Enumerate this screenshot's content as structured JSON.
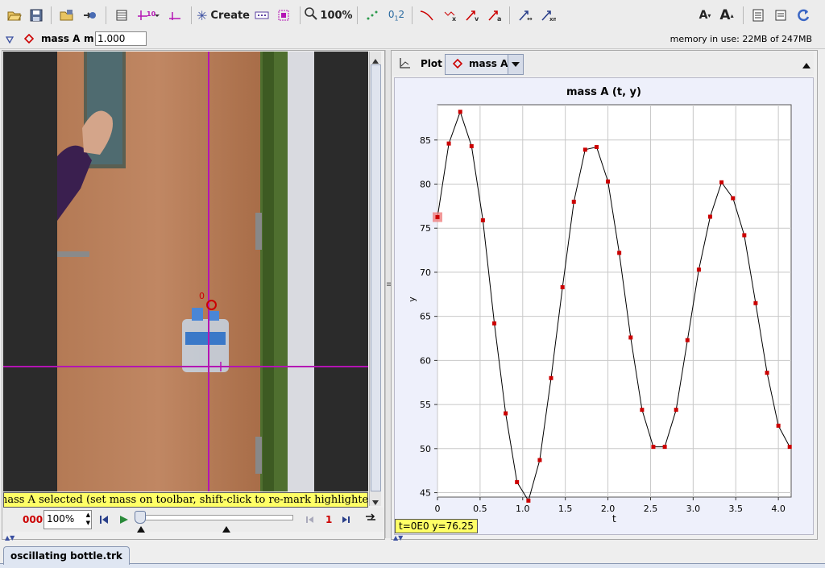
{
  "toolbar": {
    "create_label": "Create",
    "zoom_label": "100%",
    "font_smaller": "A",
    "font_larger": "A"
  },
  "trackbar": {
    "track_name": "mass A",
    "mass_label": "m",
    "mass_value": "1.000",
    "memory": "memory in use: 22MB of 247MB"
  },
  "video": {
    "origin_label": "0",
    "status": "mass A selected (set mass on toolbar, shift-click to re-mark highlighted position)"
  },
  "player": {
    "frame_counter": "000",
    "zoom": "100%",
    "step_size": "1"
  },
  "plot": {
    "tab_label": "Plot",
    "track_select": "mass A",
    "readout": "t=0E0  y=76.25"
  },
  "colors": {
    "track_red": "#cc0000",
    "axis_magenta": "#b414b4",
    "readout_yellow": "#ffff66"
  },
  "file_tab": "oscillating bottle.trk",
  "chart_data": {
    "type": "line",
    "title": "mass A (t, y)",
    "xlabel": "t",
    "ylabel": "y",
    "xlim": [
      0,
      4.15
    ],
    "ylim": [
      44.5,
      89
    ],
    "xticks": [
      "0",
      "0.5",
      "1.0",
      "1.5",
      "2.0",
      "2.5",
      "3.0",
      "3.5",
      "4.0"
    ],
    "xtick_values": [
      0,
      0.5,
      1.0,
      1.5,
      2.0,
      2.5,
      3.0,
      3.5,
      4.0
    ],
    "yticks": [
      "45",
      "50",
      "55",
      "60",
      "65",
      "70",
      "75",
      "80",
      "85"
    ],
    "ytick_values": [
      45,
      50,
      55,
      60,
      65,
      70,
      75,
      80,
      85
    ],
    "grid": true,
    "highlight_index": 0,
    "series": [
      {
        "x": [
          0,
          0.133,
          0.267,
          0.4,
          0.533,
          0.667,
          0.8,
          0.933,
          1.067,
          1.2,
          1.333,
          1.467,
          1.6,
          1.733,
          1.867,
          2.0,
          2.133,
          2.267,
          2.4,
          2.533,
          2.667,
          2.8,
          2.933,
          3.067,
          3.2,
          3.333,
          3.467,
          3.6,
          3.733,
          3.867,
          4.0,
          4.133
        ],
        "y": [
          76.25,
          84.6,
          88.2,
          84.3,
          75.9,
          64.2,
          54.0,
          46.2,
          44.1,
          48.7,
          58.0,
          68.3,
          78.0,
          83.9,
          84.2,
          80.3,
          72.2,
          62.6,
          54.4,
          50.2,
          50.2,
          54.4,
          62.3,
          70.3,
          76.3,
          80.2,
          78.4,
          74.2,
          66.5,
          58.6,
          52.6,
          50.2
        ]
      }
    ]
  }
}
